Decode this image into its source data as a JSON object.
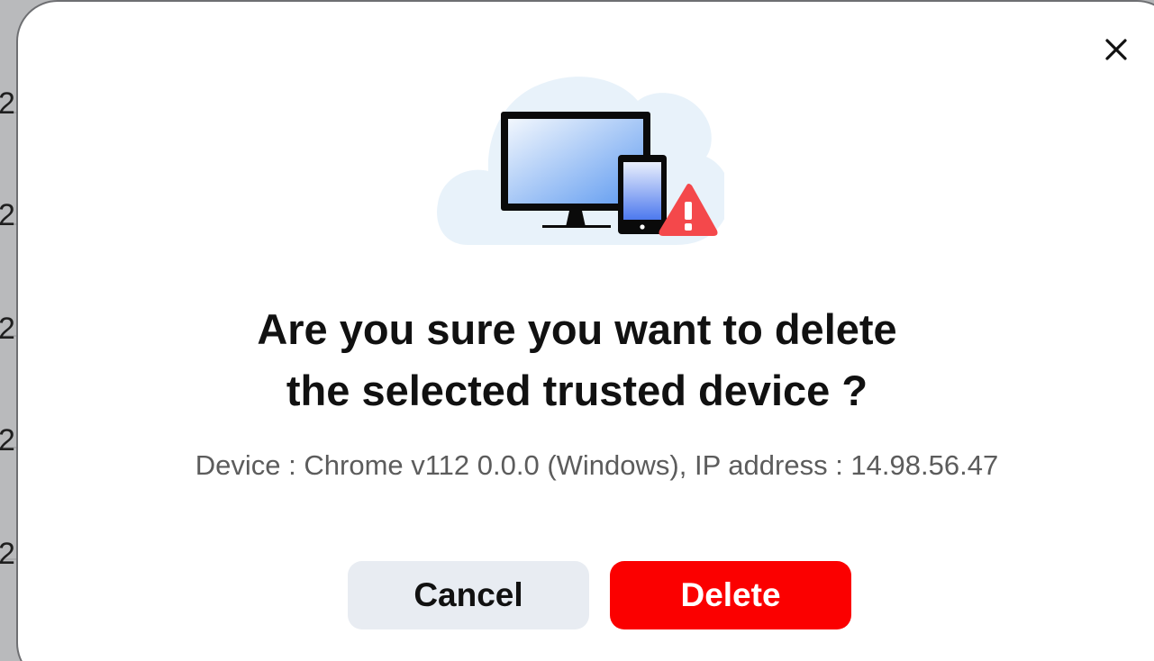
{
  "background": {
    "row_digits": [
      "2",
      "2",
      "2",
      "2",
      "2"
    ]
  },
  "dialog": {
    "close_icon": "close-icon",
    "illustration_icon": "device-warning-icon",
    "title_line1": "Are you sure you want to delete",
    "title_line2": "the selected trusted device ?",
    "detail": "Device : Chrome v112 0.0.0 (Windows), IP address : 14.98.56.47",
    "cancel_label": "Cancel",
    "delete_label": "Delete"
  },
  "colors": {
    "delete_button": "#fb0000",
    "cancel_button": "#e8ecf2",
    "warning": "#f4484b",
    "cloud": "#e8f2fa"
  }
}
